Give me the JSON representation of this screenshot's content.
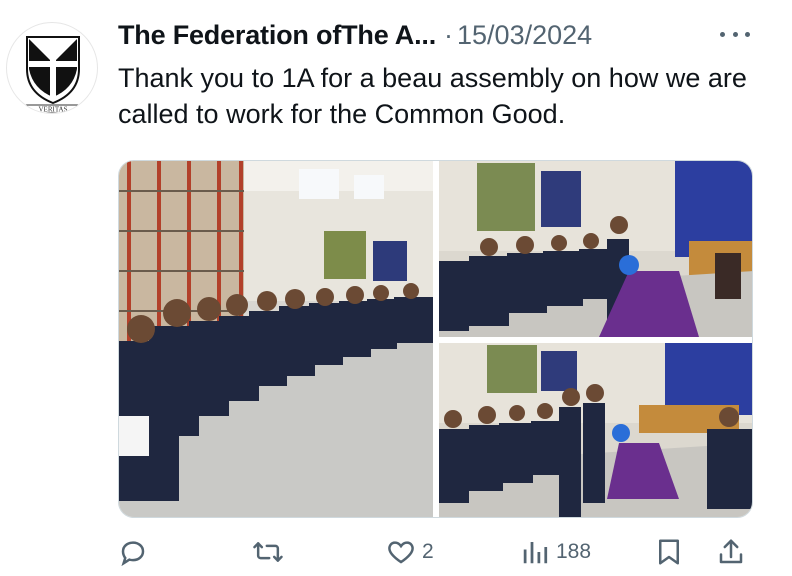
{
  "tweet": {
    "author": "The Federation ofThe A...",
    "separator": "·",
    "date": "15/03/2024",
    "text": "Thank you to 1A for a beau assembly on how we are called to work for the Common Good.",
    "avatar_motto": "VERITAS"
  },
  "actions": {
    "reply_count": "",
    "retweet_count": "",
    "like_count": "2",
    "views_count": "188"
  },
  "icons": {
    "reply": "reply-icon",
    "retweet": "retweet-icon",
    "like": "heart-icon",
    "views": "views-icon",
    "bookmark": "bookmark-icon",
    "share": "share-icon",
    "more": "more-icon"
  },
  "colors": {
    "text_primary": "#0f1419",
    "text_secondary": "#536471",
    "border": "#cfd9de"
  }
}
